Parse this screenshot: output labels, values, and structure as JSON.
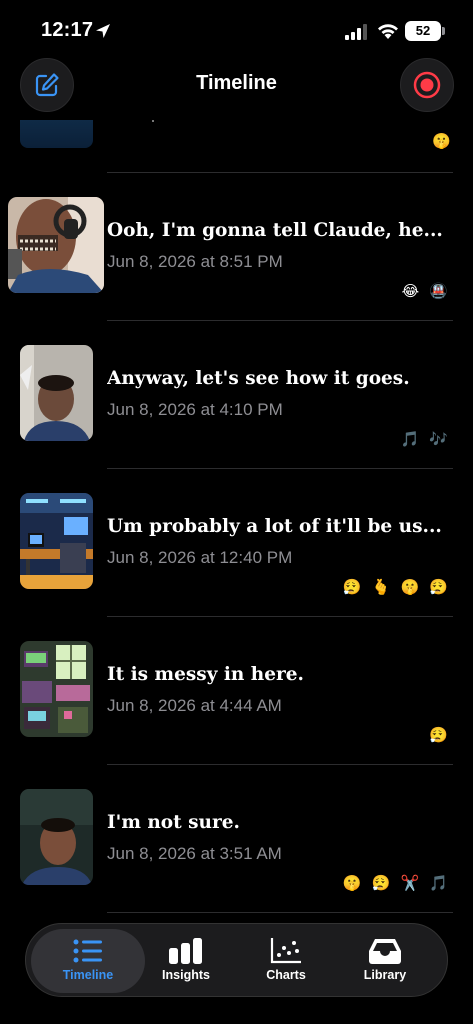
{
  "status_bar": {
    "time": "12:17",
    "battery": "52"
  },
  "header": {
    "title": "Timeline"
  },
  "partial_entry": {
    "emojis": "🤫"
  },
  "entries": [
    {
      "title": "Ooh, I'm gonna tell Claude, he...",
      "date": "Jun 8, 2026 at 8:51 PM",
      "emojis": "😂 🚇",
      "thumbnail": "robot-face-headphones"
    },
    {
      "title": "Anyway, let's see how it goes.",
      "date": "Jun 8, 2026 at 4:10 PM",
      "emojis": "🎵 🎶",
      "thumbnail": "man-portrait-indoor"
    },
    {
      "title": "Um probably a lot of it'll be us...",
      "date": "Jun 8, 2026 at 12:40 PM",
      "emojis": "😮‍💨 🫰 🤫 😮‍💨",
      "thumbnail": "futuristic-workshop"
    },
    {
      "title": "It is messy in here.",
      "date": "Jun 8, 2026 at 4:44 AM",
      "emojis": "😮‍💨",
      "thumbnail": "cluttered-room"
    },
    {
      "title": "I'm not sure.",
      "date": "Jun 8, 2026 at 3:51 AM",
      "emojis": "🤫 😮‍💨 ✂️ 🎵",
      "thumbnail": "man-portrait-dark"
    }
  ],
  "tabs": [
    {
      "label": "Timeline",
      "icon": "list-icon",
      "active": true
    },
    {
      "label": "Insights",
      "icon": "bar-chart-icon",
      "active": false
    },
    {
      "label": "Charts",
      "icon": "scatter-chart-icon",
      "active": false
    },
    {
      "label": "Library",
      "icon": "inbox-tray-icon",
      "active": false
    }
  ],
  "colors": {
    "background": "#000000",
    "accent_blue": "#3a94f5",
    "record_red": "#ff3b47",
    "secondary_text": "#8e8e93"
  }
}
